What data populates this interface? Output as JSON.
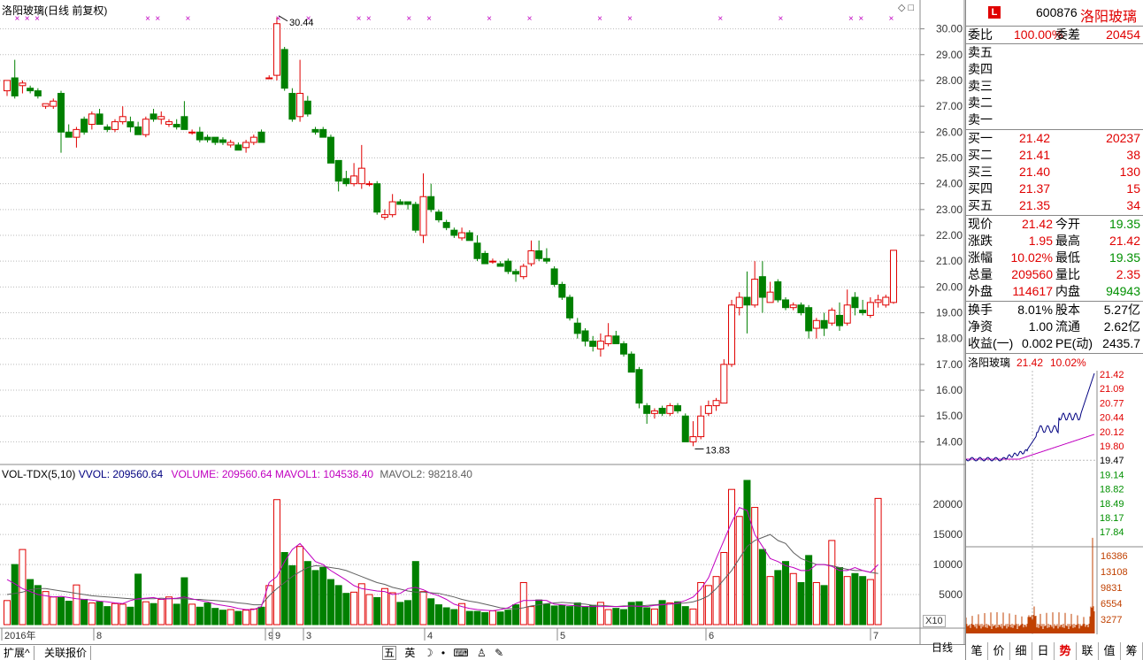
{
  "chart_title": "洛阳玻璃(日线 前复权)",
  "price_axis": [
    "30.00",
    "29.00",
    "28.00",
    "27.00",
    "26.00",
    "25.00",
    "24.00",
    "23.00",
    "22.00",
    "21.00",
    "20.00",
    "19.00",
    "18.00",
    "17.00",
    "16.00",
    "15.00",
    "14.00"
  ],
  "price_high_label": "30.44",
  "price_low_label": "13.83",
  "vol_header": {
    "name": "VOL-TDX(5,10)",
    "vvol": "VVOL: 209560.64",
    "volume": "VOLUME: 209560.64",
    "mavol1": "MAVOL1: 104538.40",
    "mavol2": "MAVOL2: 98218.40"
  },
  "vol_axis": [
    "20000",
    "15000",
    "10000",
    "5000"
  ],
  "vol_unit": "X10",
  "date_axis": [
    "2016年",
    "8",
    "9",
    "9",
    "3",
    "4",
    "5",
    "6",
    "6",
    "7"
  ],
  "bottom_tabs": [
    "扩展^",
    "关联报价"
  ],
  "period_label": "日线",
  "ime_bar": [
    "五",
    "英"
  ],
  "quote": {
    "code": "600876",
    "name": "洛阳玻璃",
    "logo": "L",
    "weibi_label": "委比",
    "weibi": "100.00%",
    "weicha_label": "委差",
    "weicha": "20454",
    "sell": [
      {
        "label": "卖五"
      },
      {
        "label": "卖四"
      },
      {
        "label": "卖三"
      },
      {
        "label": "卖二"
      },
      {
        "label": "卖一"
      }
    ],
    "buy": [
      {
        "label": "买一",
        "price": "21.42",
        "vol": "20237"
      },
      {
        "label": "买二",
        "price": "21.41",
        "vol": "38"
      },
      {
        "label": "买三",
        "price": "21.40",
        "vol": "130"
      },
      {
        "label": "买四",
        "price": "21.37",
        "vol": "15"
      },
      {
        "label": "买五",
        "price": "21.35",
        "vol": "34"
      }
    ],
    "stats": [
      {
        "l1": "现价",
        "v1": "21.42",
        "c1": "red",
        "l2": "今开",
        "v2": "19.35",
        "c2": "green"
      },
      {
        "l1": "涨跌",
        "v1": "1.95",
        "c1": "red",
        "l2": "最高",
        "v2": "21.42",
        "c2": "red"
      },
      {
        "l1": "涨幅",
        "v1": "10.02%",
        "c1": "red",
        "l2": "最低",
        "v2": "19.35",
        "c2": "green"
      },
      {
        "l1": "总量",
        "v1": "209560",
        "c1": "red",
        "l2": "量比",
        "v2": "2.35",
        "c2": "red"
      },
      {
        "l1": "外盘",
        "v1": "114617",
        "c1": "red",
        "l2": "内盘",
        "v2": "94943",
        "c2": "green"
      }
    ],
    "stats2": [
      {
        "l1": "换手",
        "v1": "8.01%",
        "l2": "股本",
        "v2": "5.27亿"
      },
      {
        "l1": "净资",
        "v1": "1.00",
        "l2": "流通",
        "v2": "2.62亿"
      },
      {
        "l1": "收益(一)",
        "v1": "0.002",
        "l2": "PE(动)",
        "v2": "2435.7"
      }
    ]
  },
  "mini": {
    "title": "洛阳玻璃",
    "price": "21.42",
    "pct": "10.02%",
    "price_ticks": [
      "21.42",
      "21.09",
      "20.77",
      "20.44",
      "20.12",
      "19.80",
      "19.47",
      "19.14",
      "18.82",
      "18.49",
      "18.17",
      "17.84"
    ],
    "vol_ticks": [
      "16386",
      "13108",
      "9831",
      "6554",
      "3277"
    ]
  },
  "right_tabs": [
    "笔",
    "价",
    "细",
    "日",
    "势",
    "联",
    "值",
    "筹"
  ],
  "colors": {
    "up": "#e00000",
    "down": "#008000",
    "mavol1": "#c000c0",
    "mavol2": "#606060"
  },
  "chart_data": {
    "type": "candlestick",
    "price_range": [
      13.5,
      30.5
    ],
    "candles": [
      {
        "o": 27.6,
        "h": 28.0,
        "l": 27.4,
        "c": 28.0
      },
      {
        "o": 28.1,
        "h": 28.8,
        "l": 27.3,
        "c": 27.4
      },
      {
        "o": 27.8,
        "h": 28.0,
        "l": 27.5,
        "c": 27.9
      },
      {
        "o": 27.7,
        "h": 27.8,
        "l": 27.5,
        "c": 27.6
      },
      {
        "o": 27.6,
        "h": 27.7,
        "l": 27.3,
        "c": 27.4
      },
      {
        "o": 27.0,
        "h": 27.1,
        "l": 26.9,
        "c": 27.1
      },
      {
        "o": 27.0,
        "h": 27.3,
        "l": 26.9,
        "c": 27.2
      },
      {
        "o": 27.5,
        "h": 27.6,
        "l": 25.2,
        "c": 26.0
      },
      {
        "o": 26.0,
        "h": 26.3,
        "l": 25.8,
        "c": 25.8
      },
      {
        "o": 25.8,
        "h": 26.2,
        "l": 25.4,
        "c": 26.1
      },
      {
        "o": 26.5,
        "h": 26.6,
        "l": 25.9,
        "c": 26.0
      },
      {
        "o": 26.3,
        "h": 26.8,
        "l": 26.1,
        "c": 26.7
      },
      {
        "o": 26.7,
        "h": 26.9,
        "l": 26.3,
        "c": 26.3
      },
      {
        "o": 26.2,
        "h": 26.3,
        "l": 26.0,
        "c": 26.1
      },
      {
        "o": 26.1,
        "h": 26.5,
        "l": 26.0,
        "c": 26.4
      },
      {
        "o": 26.4,
        "h": 27.0,
        "l": 26.3,
        "c": 26.6
      },
      {
        "o": 26.4,
        "h": 26.6,
        "l": 26.0,
        "c": 26.2
      },
      {
        "o": 26.2,
        "h": 26.4,
        "l": 25.9,
        "c": 25.9
      },
      {
        "o": 25.9,
        "h": 26.6,
        "l": 25.8,
        "c": 26.5
      },
      {
        "o": 26.7,
        "h": 26.9,
        "l": 26.4,
        "c": 26.5
      },
      {
        "o": 26.5,
        "h": 26.8,
        "l": 26.3,
        "c": 26.6
      },
      {
        "o": 26.3,
        "h": 26.5,
        "l": 26.2,
        "c": 26.4
      },
      {
        "o": 26.3,
        "h": 26.5,
        "l": 26.1,
        "c": 26.2
      },
      {
        "o": 26.6,
        "h": 27.2,
        "l": 26.1,
        "c": 26.1
      },
      {
        "o": 26.0,
        "h": 26.1,
        "l": 25.9,
        "c": 26.0
      },
      {
        "o": 26.0,
        "h": 26.2,
        "l": 25.6,
        "c": 25.7
      },
      {
        "o": 25.8,
        "h": 25.9,
        "l": 25.6,
        "c": 25.7
      },
      {
        "o": 25.8,
        "h": 25.8,
        "l": 25.5,
        "c": 25.6
      },
      {
        "o": 25.7,
        "h": 25.8,
        "l": 25.5,
        "c": 25.6
      },
      {
        "o": 25.5,
        "h": 25.7,
        "l": 25.4,
        "c": 25.6
      },
      {
        "o": 25.5,
        "h": 25.6,
        "l": 25.3,
        "c": 25.3
      },
      {
        "o": 25.4,
        "h": 25.7,
        "l": 25.2,
        "c": 25.6
      },
      {
        "o": 25.6,
        "h": 25.9,
        "l": 25.5,
        "c": 25.8
      },
      {
        "o": 26.0,
        "h": 26.1,
        "l": 25.6,
        "c": 25.6
      },
      {
        "o": 28.1,
        "h": 28.2,
        "l": 28.1,
        "c": 28.1
      },
      {
        "o": 28.2,
        "h": 30.44,
        "l": 28.0,
        "c": 30.2
      },
      {
        "o": 29.2,
        "h": 29.3,
        "l": 27.6,
        "c": 27.7
      },
      {
        "o": 27.5,
        "h": 27.7,
        "l": 26.4,
        "c": 26.5
      },
      {
        "o": 26.6,
        "h": 28.8,
        "l": 26.4,
        "c": 27.5
      },
      {
        "o": 27.2,
        "h": 27.4,
        "l": 26.6,
        "c": 26.7
      },
      {
        "o": 26.1,
        "h": 26.2,
        "l": 25.9,
        "c": 26.0
      },
      {
        "o": 26.1,
        "h": 26.2,
        "l": 25.8,
        "c": 25.8
      },
      {
        "o": 25.8,
        "h": 25.9,
        "l": 24.8,
        "c": 24.8
      },
      {
        "o": 24.9,
        "h": 24.9,
        "l": 23.7,
        "c": 24.1
      },
      {
        "o": 24.2,
        "h": 24.5,
        "l": 23.9,
        "c": 24.0
      },
      {
        "o": 24.0,
        "h": 24.8,
        "l": 23.9,
        "c": 24.3
      },
      {
        "o": 24.0,
        "h": 25.5,
        "l": 23.8,
        "c": 24.6
      },
      {
        "o": 24.0,
        "h": 24.1,
        "l": 23.9,
        "c": 24.0
      },
      {
        "o": 24.0,
        "h": 24.1,
        "l": 22.8,
        "c": 22.9
      },
      {
        "o": 22.7,
        "h": 23.0,
        "l": 22.6,
        "c": 22.8
      },
      {
        "o": 22.8,
        "h": 23.6,
        "l": 22.7,
        "c": 23.3
      },
      {
        "o": 23.3,
        "h": 23.4,
        "l": 23.2,
        "c": 23.2
      },
      {
        "o": 23.3,
        "h": 23.3,
        "l": 23.0,
        "c": 23.2
      },
      {
        "o": 23.2,
        "h": 23.3,
        "l": 22.1,
        "c": 22.2
      },
      {
        "o": 22.0,
        "h": 24.4,
        "l": 21.7,
        "c": 23.5
      },
      {
        "o": 23.5,
        "h": 24.0,
        "l": 22.9,
        "c": 23.0
      },
      {
        "o": 22.9,
        "h": 23.0,
        "l": 22.5,
        "c": 22.6
      },
      {
        "o": 22.5,
        "h": 22.6,
        "l": 22.2,
        "c": 22.3
      },
      {
        "o": 22.2,
        "h": 22.3,
        "l": 21.9,
        "c": 22.0
      },
      {
        "o": 21.9,
        "h": 22.3,
        "l": 21.8,
        "c": 22.1
      },
      {
        "o": 22.1,
        "h": 22.2,
        "l": 21.8,
        "c": 21.8
      },
      {
        "o": 21.7,
        "h": 22.0,
        "l": 21.0,
        "c": 21.1
      },
      {
        "o": 21.3,
        "h": 21.4,
        "l": 20.9,
        "c": 20.9
      },
      {
        "o": 21.0,
        "h": 21.1,
        "l": 20.9,
        "c": 21.0
      },
      {
        "o": 20.9,
        "h": 21.0,
        "l": 20.8,
        "c": 20.8
      },
      {
        "o": 21.0,
        "h": 21.1,
        "l": 20.5,
        "c": 20.6
      },
      {
        "o": 20.6,
        "h": 20.7,
        "l": 20.2,
        "c": 20.5
      },
      {
        "o": 20.4,
        "h": 20.9,
        "l": 20.3,
        "c": 20.8
      },
      {
        "o": 20.9,
        "h": 21.8,
        "l": 20.8,
        "c": 21.4
      },
      {
        "o": 21.4,
        "h": 21.8,
        "l": 21.0,
        "c": 21.1
      },
      {
        "o": 21.1,
        "h": 21.5,
        "l": 20.9,
        "c": 21.0
      },
      {
        "o": 20.7,
        "h": 20.8,
        "l": 20.0,
        "c": 20.1
      },
      {
        "o": 20.1,
        "h": 20.2,
        "l": 19.5,
        "c": 19.6
      },
      {
        "o": 19.6,
        "h": 19.7,
        "l": 18.7,
        "c": 18.8
      },
      {
        "o": 18.6,
        "h": 18.8,
        "l": 18.0,
        "c": 18.2
      },
      {
        "o": 18.3,
        "h": 18.4,
        "l": 17.7,
        "c": 17.9
      },
      {
        "o": 17.9,
        "h": 18.1,
        "l": 17.5,
        "c": 17.7
      },
      {
        "o": 17.6,
        "h": 18.2,
        "l": 17.3,
        "c": 17.9
      },
      {
        "o": 17.8,
        "h": 18.6,
        "l": 17.7,
        "c": 18.1
      },
      {
        "o": 18.1,
        "h": 18.3,
        "l": 17.8,
        "c": 17.8
      },
      {
        "o": 17.8,
        "h": 17.9,
        "l": 17.3,
        "c": 17.4
      },
      {
        "o": 17.4,
        "h": 17.5,
        "l": 16.9,
        "c": 16.7
      },
      {
        "o": 16.8,
        "h": 16.9,
        "l": 15.3,
        "c": 15.5
      },
      {
        "o": 15.4,
        "h": 15.5,
        "l": 14.7,
        "c": 15.1
      },
      {
        "o": 15.1,
        "h": 15.3,
        "l": 14.9,
        "c": 15.2
      },
      {
        "o": 15.3,
        "h": 15.4,
        "l": 15.0,
        "c": 15.1
      },
      {
        "o": 15.1,
        "h": 15.5,
        "l": 15.0,
        "c": 15.4
      },
      {
        "o": 15.4,
        "h": 15.5,
        "l": 15.1,
        "c": 15.2
      },
      {
        "o": 15.0,
        "h": 15.1,
        "l": 14.0,
        "c": 14.0
      },
      {
        "o": 14.0,
        "h": 14.8,
        "l": 13.83,
        "c": 14.2
      },
      {
        "o": 14.2,
        "h": 15.4,
        "l": 14.1,
        "c": 15.0
      },
      {
        "o": 15.1,
        "h": 15.6,
        "l": 15.0,
        "c": 15.4
      },
      {
        "o": 15.4,
        "h": 15.7,
        "l": 15.2,
        "c": 15.6
      },
      {
        "o": 15.5,
        "h": 17.2,
        "l": 15.5,
        "c": 17.0
      },
      {
        "o": 17.0,
        "h": 19.5,
        "l": 16.9,
        "c": 19.3
      },
      {
        "o": 19.2,
        "h": 19.8,
        "l": 18.9,
        "c": 19.6
      },
      {
        "o": 19.6,
        "h": 20.6,
        "l": 18.2,
        "c": 19.3
      },
      {
        "o": 19.3,
        "h": 21.0,
        "l": 19.2,
        "c": 20.3
      },
      {
        "o": 20.4,
        "h": 21.0,
        "l": 19.0,
        "c": 19.6
      },
      {
        "o": 19.4,
        "h": 20.2,
        "l": 19.4,
        "c": 19.8
      },
      {
        "o": 20.2,
        "h": 20.3,
        "l": 19.4,
        "c": 19.5
      },
      {
        "o": 19.5,
        "h": 19.6,
        "l": 19.1,
        "c": 19.2
      },
      {
        "o": 19.2,
        "h": 19.4,
        "l": 19.1,
        "c": 19.3
      },
      {
        "o": 19.3,
        "h": 19.4,
        "l": 18.9,
        "c": 19.0
      },
      {
        "o": 19.2,
        "h": 19.3,
        "l": 18.0,
        "c": 18.3
      },
      {
        "o": 18.4,
        "h": 18.8,
        "l": 18.0,
        "c": 18.7
      },
      {
        "o": 18.7,
        "h": 19.0,
        "l": 18.1,
        "c": 18.4
      },
      {
        "o": 18.6,
        "h": 19.2,
        "l": 18.5,
        "c": 19.1
      },
      {
        "o": 18.9,
        "h": 19.4,
        "l": 18.3,
        "c": 18.5
      },
      {
        "o": 18.6,
        "h": 19.9,
        "l": 18.5,
        "c": 19.3
      },
      {
        "o": 19.6,
        "h": 19.8,
        "l": 18.9,
        "c": 19.2
      },
      {
        "o": 19.1,
        "h": 19.5,
        "l": 18.9,
        "c": 19.0
      },
      {
        "o": 18.9,
        "h": 19.6,
        "l": 18.8,
        "c": 19.4
      },
      {
        "o": 19.4,
        "h": 19.7,
        "l": 19.2,
        "c": 19.5
      },
      {
        "o": 19.3,
        "h": 19.7,
        "l": 19.2,
        "c": 19.6
      },
      {
        "o": 19.4,
        "h": 21.42,
        "l": 19.35,
        "c": 21.42
      }
    ],
    "volumes": [
      4000,
      10000,
      12500,
      7500,
      6500,
      5500,
      4600,
      4500,
      3900,
      6600,
      4200,
      3600,
      3800,
      3000,
      3500,
      3400,
      2900,
      8400,
      3800,
      3500,
      4200,
      4600,
      3400,
      7800,
      3400,
      2900,
      3600,
      2700,
      2400,
      2500,
      2200,
      2400,
      2600,
      2900,
      6500,
      20800,
      12000,
      9800,
      13000,
      10500,
      9000,
      9500,
      7500,
      6500,
      5200,
      5400,
      6800,
      5000,
      4500,
      6000,
      5300,
      3700,
      4000,
      10500,
      5500,
      4300,
      3300,
      2800,
      2500,
      3500,
      2200,
      2200,
      2000,
      2300,
      2100,
      2400,
      3300,
      7000,
      3000,
      4100,
      3400,
      3100,
      3200,
      3000,
      3600,
      3000,
      3200,
      3700,
      2500,
      2700,
      2500,
      3700,
      3800,
      2800,
      2600,
      4000,
      3600,
      3800,
      3000,
      2600,
      7000,
      6500,
      8000,
      12000,
      22500,
      18000,
      24000,
      19500,
      12500,
      8000,
      9000,
      10500,
      8500,
      7000,
      11500,
      7000,
      6500,
      14000,
      9500,
      8000,
      8500,
      8000,
      7500,
      21000
    ],
    "mavol1": [
      7500,
      6800,
      6000,
      5500,
      5000,
      4800,
      4600,
      4700,
      4500,
      4300,
      4200,
      4100,
      3900,
      3800,
      3600,
      3500,
      4000,
      4300,
      4400,
      4500,
      4200,
      4300,
      4400,
      4600,
      4300,
      4000,
      3800,
      3400,
      3200,
      3000,
      2700,
      2500,
      2500,
      3000,
      7000,
      8000,
      10500,
      12500,
      13500,
      12000,
      10500,
      10000,
      9000,
      8200,
      7400,
      6500,
      6000,
      5800,
      5600,
      5500,
      5000,
      5200,
      6000,
      6200,
      5800,
      5200,
      4800,
      4200,
      3400,
      3000,
      2700,
      2500,
      2400,
      2300,
      2500,
      2800,
      3500,
      4000,
      4000,
      4100,
      4000,
      3400,
      3300,
      3200,
      3100,
      3000,
      3000,
      3000,
      3000,
      3000,
      3000,
      3100,
      3000,
      3000,
      3200,
      3300,
      3400,
      3600,
      4000,
      4600,
      5900,
      7800,
      11000,
      14000,
      17000,
      19500,
      19000,
      15000,
      13000,
      11000,
      10500,
      9800,
      9500,
      9000,
      9000,
      10000,
      10000,
      9700,
      9000,
      9000,
      9500,
      9000,
      8700,
      10000
    ],
    "mavol2": [
      5000,
      5200,
      5400,
      5800,
      6000,
      6000,
      5800,
      5600,
      5400,
      5200,
      5000,
      4800,
      4700,
      4600,
      4500,
      4400,
      4300,
      4200,
      4300,
      4300,
      4400,
      4300,
      4300,
      4300,
      4200,
      4200,
      4100,
      4000,
      3900,
      3800,
      3600,
      3500,
      3300,
      3300,
      4800,
      6000,
      7000,
      8000,
      8800,
      9500,
      9800,
      9700,
      9500,
      9300,
      9000,
      8500,
      8000,
      7500,
      7000,
      6700,
      6200,
      5900,
      5600,
      5400,
      5400,
      5300,
      5200,
      4900,
      4600,
      4200,
      3900,
      3700,
      3400,
      3100,
      2800,
      2700,
      2600,
      2800,
      3100,
      3300,
      3500,
      3600,
      3700,
      3600,
      3500,
      3400,
      3200,
      3200,
      3100,
      3000,
      3100,
      3100,
      3100,
      3200,
      3300,
      3400,
      3400,
      3500,
      3600,
      3800,
      4200,
      4800,
      6000,
      7500,
      9000,
      11000,
      13000,
      14000,
      14500,
      15000,
      14000,
      13500,
      12000,
      11000,
      10500,
      10000,
      10000,
      9800,
      9500,
      9200,
      9000,
      9000,
      8700,
      8500
    ],
    "x_marks": [
      1,
      2,
      3,
      14,
      15,
      18,
      27,
      30,
      35,
      36,
      40,
      42,
      48,
      52,
      59,
      62,
      71,
      77,
      84,
      85,
      88
    ]
  }
}
